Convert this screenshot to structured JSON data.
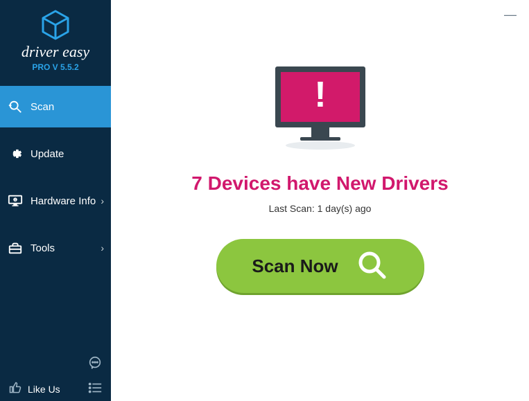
{
  "brand": {
    "name": "driver easy",
    "version": "PRO V 5.5.2"
  },
  "sidebar": {
    "items": [
      {
        "label": "Scan",
        "has_chevron": false,
        "active": true
      },
      {
        "label": "Update",
        "has_chevron": false,
        "active": false
      },
      {
        "label": "Hardware Info",
        "has_chevron": true,
        "active": false
      },
      {
        "label": "Tools",
        "has_chevron": true,
        "active": false
      }
    ],
    "like_us": "Like Us"
  },
  "main": {
    "status_headline": "7 Devices have New Drivers",
    "last_scan": "Last Scan: 1 day(s) ago",
    "scan_button": "Scan Now"
  },
  "colors": {
    "sidebar_bg": "#0a2a43",
    "sidebar_active": "#2a95d6",
    "accent_blue": "#2aa3e8",
    "headline": "#d1186d",
    "button": "#8cc63f",
    "monitor_screen": "#d21a6a"
  }
}
